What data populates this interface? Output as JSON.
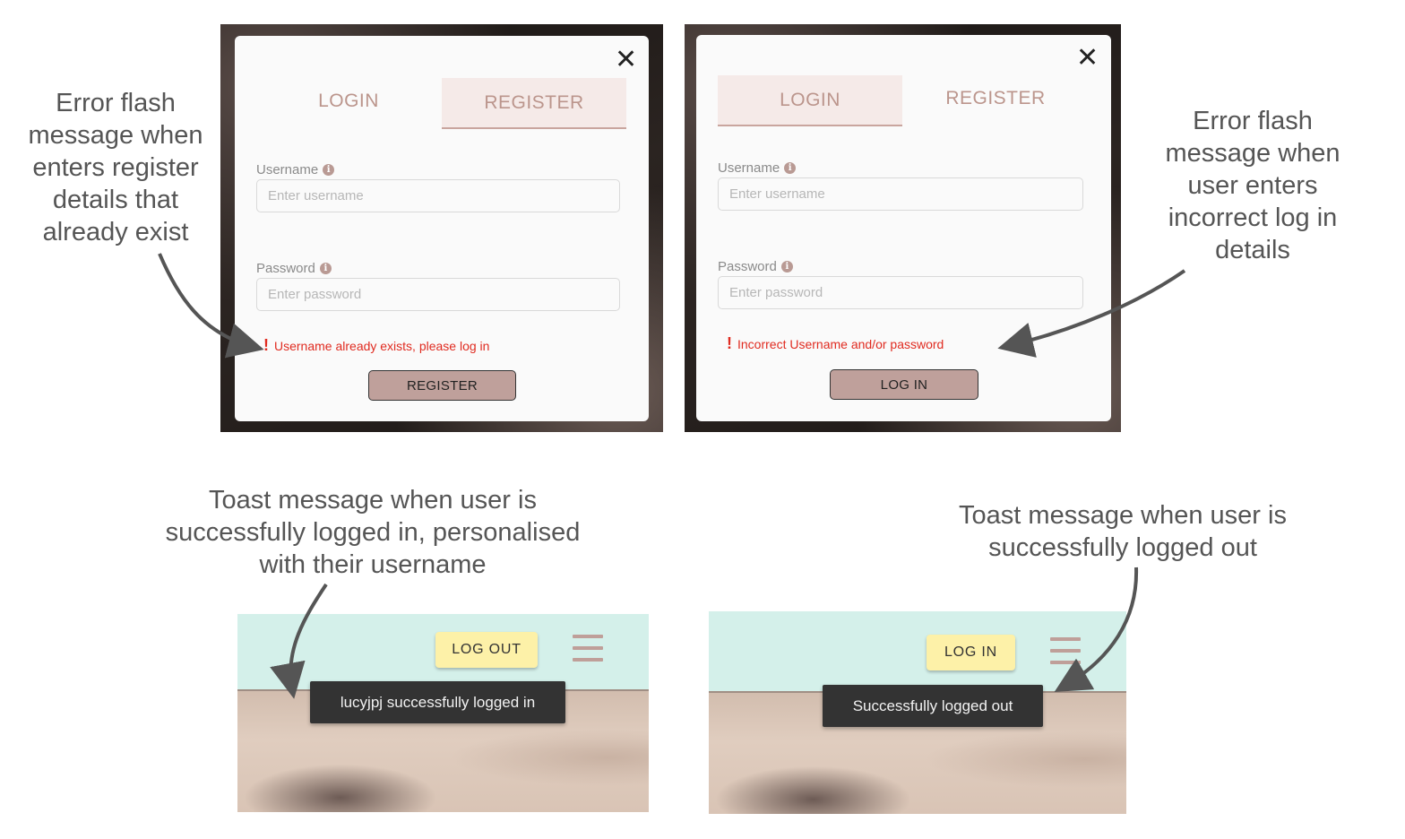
{
  "register_panel": {
    "close_icon": "✕",
    "tab_login": "LOGIN",
    "tab_register": "REGISTER",
    "active_tab": "register",
    "username_label": "Username",
    "username_placeholder": "Enter username",
    "password_label": "Password",
    "password_placeholder": "Enter password",
    "info_icon": "i",
    "error_icon": "!",
    "error_text": "Username already exists, please log in",
    "submit_label": "REGISTER"
  },
  "login_panel": {
    "close_icon": "✕",
    "tab_login": "LOGIN",
    "tab_register": "REGISTER",
    "active_tab": "login",
    "username_label": "Username",
    "username_placeholder": "Enter username",
    "password_label": "Password",
    "password_placeholder": "Enter password",
    "info_icon": "i",
    "error_icon": "!",
    "error_text": "Incorrect Username and/or password",
    "submit_label": "LOG IN"
  },
  "logged_in_panel": {
    "nav_button": "LOG OUT",
    "toast": "lucyjpj successfully logged in"
  },
  "logged_out_panel": {
    "nav_button": "LOG IN",
    "toast": "Successfully logged out"
  },
  "annotations": {
    "register_error": "Error flash\nmessage when\nenters register\ndetails that\nalready exist",
    "login_error": "Error flash\nmessage when\nuser enters\nincorrect log in\ndetails",
    "login_toast": "Toast message when user is\nsuccessfully logged in, personalised\nwith their username",
    "logout_toast": "Toast message when user is\nsuccessfully logged out"
  },
  "colors": {
    "accent_pink": "#bb958c",
    "error_red": "#e02b20",
    "nav_mint": "#d4f0ea",
    "nav_button_yellow": "#fdf1a8",
    "toast_dark": "#333333"
  },
  "icons": [
    "close-icon",
    "info-icon",
    "error-icon",
    "hamburger-menu-icon",
    "arrow-icon"
  ]
}
